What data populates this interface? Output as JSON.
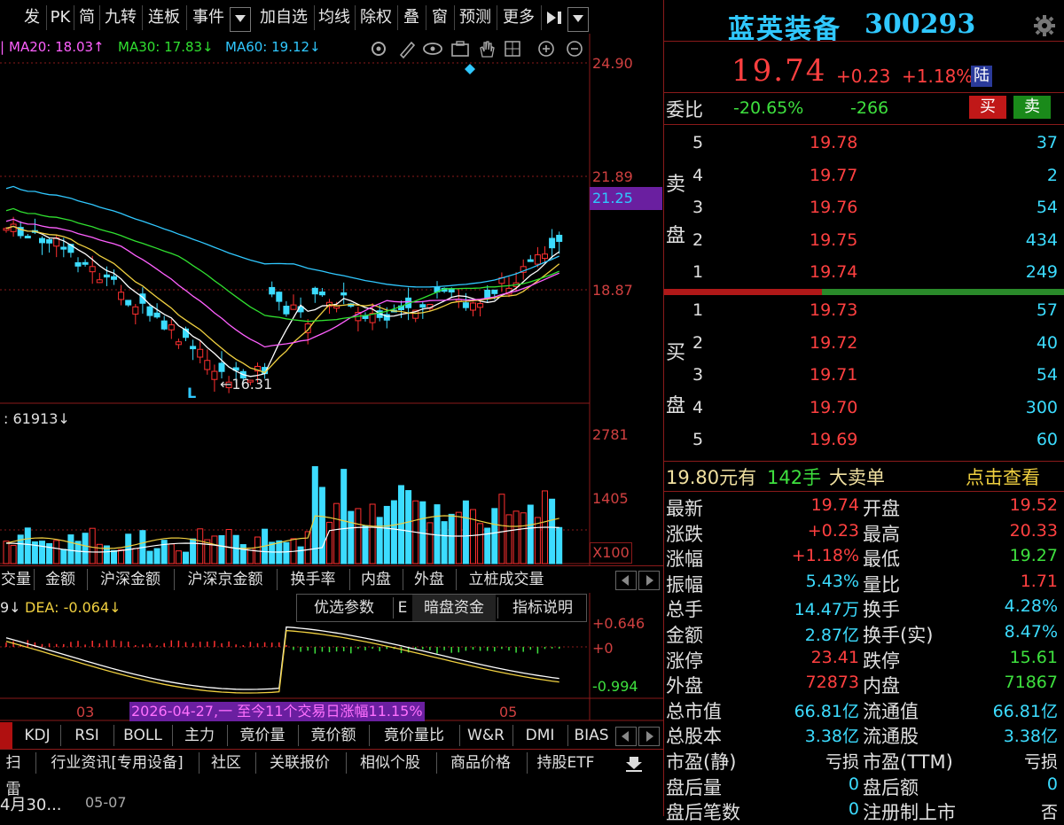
{
  "toolbar": {
    "items": [
      "发",
      "PK",
      "简",
      "九转",
      "连板",
      "事件",
      "加自选",
      "均线",
      "除权",
      "叠",
      "窗",
      "预测",
      "更多"
    ]
  },
  "main_chart": {
    "ma_indicators": [
      {
        "label": "MA20: 18.03↑",
        "color": "#ff60ff"
      },
      {
        "label": "MA30: 17.83↓",
        "color": "#30e030"
      },
      {
        "label": "MA60: 19.12↓",
        "color": "#30c8ff"
      }
    ],
    "price_axis": [
      "24.90",
      "21.89",
      "21.25",
      "18.87"
    ],
    "low_label": "←16.31",
    "low_marker": "L"
  },
  "volume_chart": {
    "label": ": 61913↓",
    "axis": [
      "2781",
      "1405",
      "X100"
    ]
  },
  "volume_tabs": [
    "交量",
    "金额",
    "沪深金额",
    "沪深京金额",
    "换手率",
    "内盘",
    "外盘",
    "立桩成交量"
  ],
  "macd": {
    "label_a": "9↓",
    "label_b": "DEA: -0.064↓",
    "buttons": [
      "优选参数",
      "暗盘资金",
      "指标说明"
    ],
    "axis": [
      "+0.646",
      "+0",
      "-0.994"
    ],
    "date_labels": [
      "03",
      "05"
    ],
    "note": "2026-04-27,一 至今11个交易日涨幅11.15%"
  },
  "indicator_tabs": [
    "KDJ",
    "RSI",
    "BOLL",
    "主力",
    "竟价量",
    "竟价额",
    "竟价量比",
    "W&R",
    "DMI",
    "BIAS"
  ],
  "info_tabs": [
    "扫雷",
    "行业资讯[专用设备]",
    "社区",
    "关联报价",
    "相似个股",
    "商品价格",
    "持股ETF"
  ],
  "news": {
    "item": "4月30...",
    "date": "05-07"
  },
  "panel": {
    "stock_name": "蓝英装备",
    "stock_code": "300293",
    "price": "19.74",
    "change": "+0.23",
    "change_pct": "+1.18%",
    "market_badge": "陆",
    "weibi_label": "委比",
    "weibi_pct": "-20.65%",
    "weicha": "-266",
    "buy_btn": "买",
    "sell_btn": "卖",
    "sell_label_1": "卖",
    "sell_label_2": "盘",
    "buy_label_1": "买",
    "buy_label_2": "盘",
    "asks": [
      {
        "level": "5",
        "price": "19.78",
        "vol": "37"
      },
      {
        "level": "4",
        "price": "19.77",
        "vol": "2"
      },
      {
        "level": "3",
        "price": "19.76",
        "vol": "54"
      },
      {
        "level": "2",
        "price": "19.75",
        "vol": "434"
      },
      {
        "level": "1",
        "price": "19.74",
        "vol": "249"
      }
    ],
    "bids": [
      {
        "level": "1",
        "price": "19.73",
        "vol": "57"
      },
      {
        "level": "2",
        "price": "19.72",
        "vol": "40"
      },
      {
        "level": "3",
        "price": "19.71",
        "vol": "54"
      },
      {
        "level": "4",
        "price": "19.70",
        "vol": "300"
      },
      {
        "level": "5",
        "price": "19.69",
        "vol": "60"
      }
    ],
    "alert": {
      "price": "19.80元有",
      "qty": "142手",
      "type": "大卖单",
      "link": "点击查看"
    },
    "quote_rows": [
      {
        "l1": "最新",
        "v1": "19.74",
        "c1": "red",
        "l2": "开盘",
        "v2": "19.52",
        "c2": "red"
      },
      {
        "l1": "涨跌",
        "v1": "+0.23",
        "c1": "red",
        "l2": "最高",
        "v2": "20.33",
        "c2": "red"
      },
      {
        "l1": "涨幅",
        "v1": "+1.18%",
        "c1": "red",
        "l2": "最低",
        "v2": "19.27",
        "c2": "green"
      },
      {
        "l1": "振幅",
        "v1": "5.43%",
        "c1": "cyan",
        "l2": "量比",
        "v2": "1.71",
        "c2": "red"
      },
      {
        "l1": "总手",
        "v1": "14.47万",
        "c1": "cyan",
        "l2": "换手",
        "v2": "4.28%",
        "c2": "cyan"
      },
      {
        "l1": "金额",
        "v1": "2.87亿",
        "c1": "cyan",
        "l2": "换手(实)",
        "v2": "8.47%",
        "c2": "cyan"
      },
      {
        "l1": "涨停",
        "v1": "23.41",
        "c1": "red",
        "l2": "跌停",
        "v2": "15.61",
        "c2": "green"
      },
      {
        "l1": "外盘",
        "v1": "72873",
        "c1": "red",
        "l2": "内盘",
        "v2": "71867",
        "c2": "green"
      },
      {
        "l1": "总市值",
        "v1": "66.81亿",
        "c1": "cyan",
        "l2": "流通值",
        "v2": "66.81亿",
        "c2": "cyan"
      },
      {
        "l1": "总股本",
        "v1": "3.38亿",
        "c1": "cyan",
        "l2": "流通股",
        "v2": "3.38亿",
        "c2": "cyan"
      },
      {
        "l1": "市盈(静)",
        "v1": "亏损",
        "c1": "white",
        "l2": "市盈(TTM)",
        "v2": "亏损",
        "c2": "white"
      },
      {
        "l1": "盘后量",
        "v1": "0",
        "c1": "cyan",
        "l2": "盘后额",
        "v2": "0",
        "c2": "cyan"
      },
      {
        "l1": "盘后笔数",
        "v1": "0",
        "c1": "cyan",
        "l2": "注册制上市",
        "v2": "否",
        "c2": "white"
      }
    ]
  }
}
